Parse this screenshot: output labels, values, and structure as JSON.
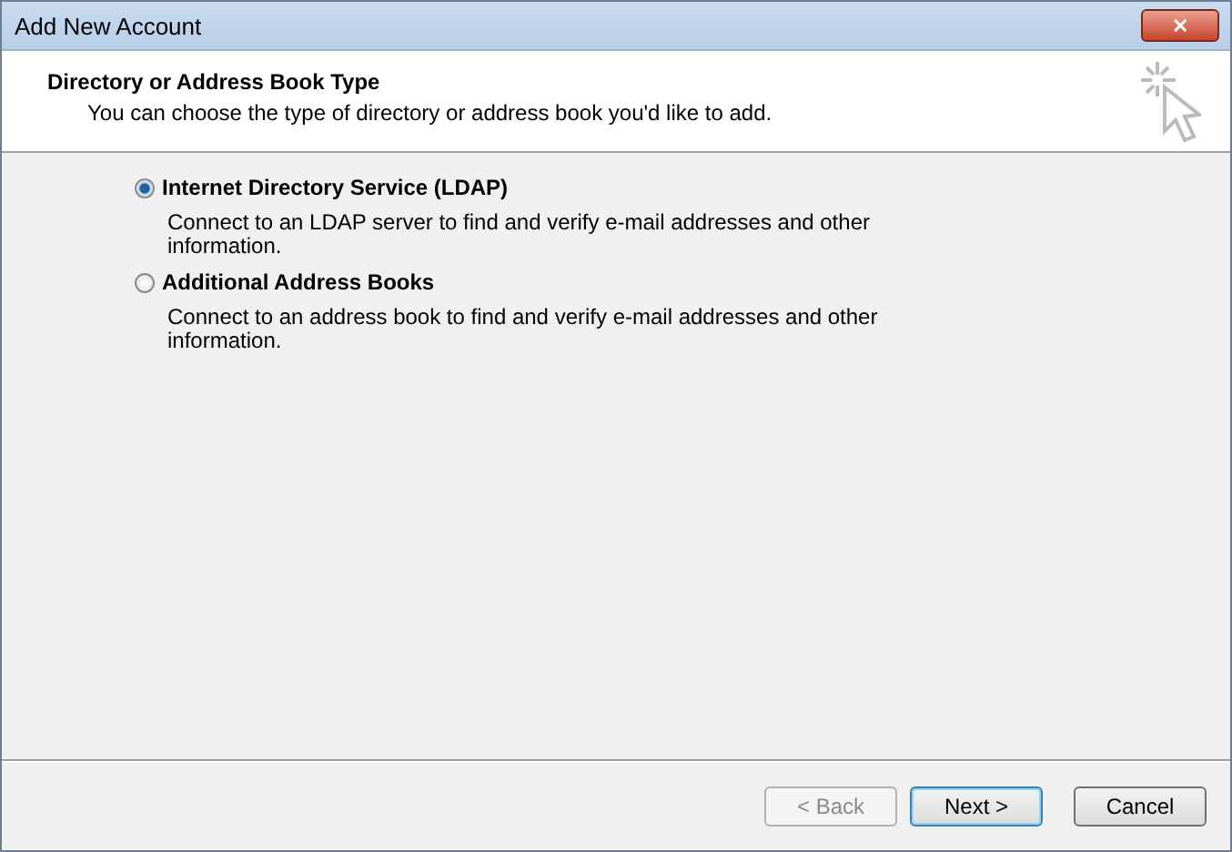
{
  "window": {
    "title": "Add New Account",
    "close": "✕"
  },
  "header": {
    "title": "Directory or Address Book Type",
    "subtitle": "You can choose the type of directory or address book you'd like to add."
  },
  "options": [
    {
      "label": "Internet Directory Service (LDAP)",
      "description": "Connect to an LDAP server to find and verify e-mail addresses and other information.",
      "selected": true
    },
    {
      "label": "Additional Address Books",
      "description": "Connect to an address book to find and verify e-mail addresses and other information.",
      "selected": false
    }
  ],
  "buttons": [
    {
      "label": "< Back",
      "disabled": true,
      "default": false
    },
    {
      "label": "Next >",
      "disabled": false,
      "default": true
    },
    {
      "label": "Cancel",
      "disabled": false,
      "default": false
    }
  ]
}
